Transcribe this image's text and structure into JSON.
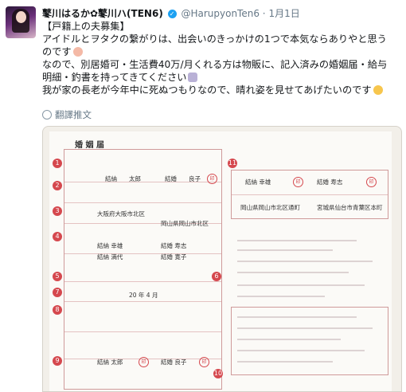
{
  "user": {
    "display_name": "鼕川はるか✿鼕川ハ(TEN6)",
    "handle": "@HarupyonTen6",
    "separator": "·",
    "date": "1月1日"
  },
  "tweet": {
    "lines": [
      "【戸籍上の夫募集】",
      "アイドルとヲタクの繋がりは、出会いのきっかけの1つで本気ならありやと思う",
      "のです",
      "なので、別居婚可・生活費40万/月くれる方は物販に、記入済みの婚姻届・給与",
      "明細・釣書を持ってきてください",
      "我が家の長老が今年中に死ぬつもりなので、晴れ姿を見せてあげたいのです"
    ],
    "translate_label": "翻譯推文"
  },
  "form": {
    "title": "婚 姻 届",
    "markers": [
      "1",
      "2",
      "3",
      "4",
      "5",
      "6",
      "7",
      "8",
      "9",
      "10",
      "11"
    ],
    "husband_name_family": "結納",
    "husband_name_given": "太郎",
    "wife_name_family": "結婚",
    "wife_name_given": "良子",
    "address_1": "大阪府大阪市北区",
    "address_2": "岡山県岡山市北区",
    "father_h": "結納 幸雄",
    "mother_h": "結納 満代",
    "father_w": "結婚 寿志",
    "mother_w": "結婚 寛子",
    "witness_1": "結納 幸雄",
    "witness_2": "結婚 寿志",
    "witness_addr_1": "岡山県岡山市北区通町",
    "witness_addr_2": "宮城県仙台市青葉区本町",
    "date_text": "20 年 4 月",
    "sign_h": "結納 太郎",
    "sign_w": "結婚 良子",
    "seal": "印"
  }
}
